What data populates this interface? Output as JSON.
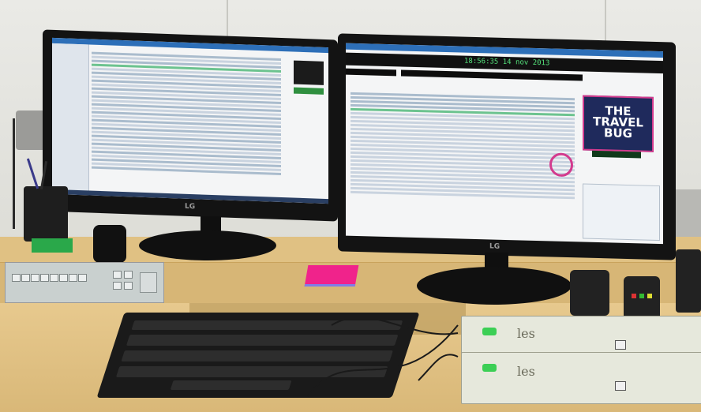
{
  "scene": {
    "left_monitor": {
      "brand": "LG"
    },
    "right_monitor": {
      "brand": "LG",
      "clock_text": "18:56:35 14 nov 2013",
      "logo_lines": [
        "THE",
        "TRAVEL",
        "BUG"
      ]
    },
    "rack": {
      "unit_label_top": "les",
      "unit_label_bottom": "les"
    },
    "colors": {
      "desk_wood": "#e0c183",
      "monitor_bezel": "#131313",
      "playlist_green": "#6cc38f",
      "logo_pink": "#d33b8e",
      "sticky_note": "#f0238b"
    }
  }
}
